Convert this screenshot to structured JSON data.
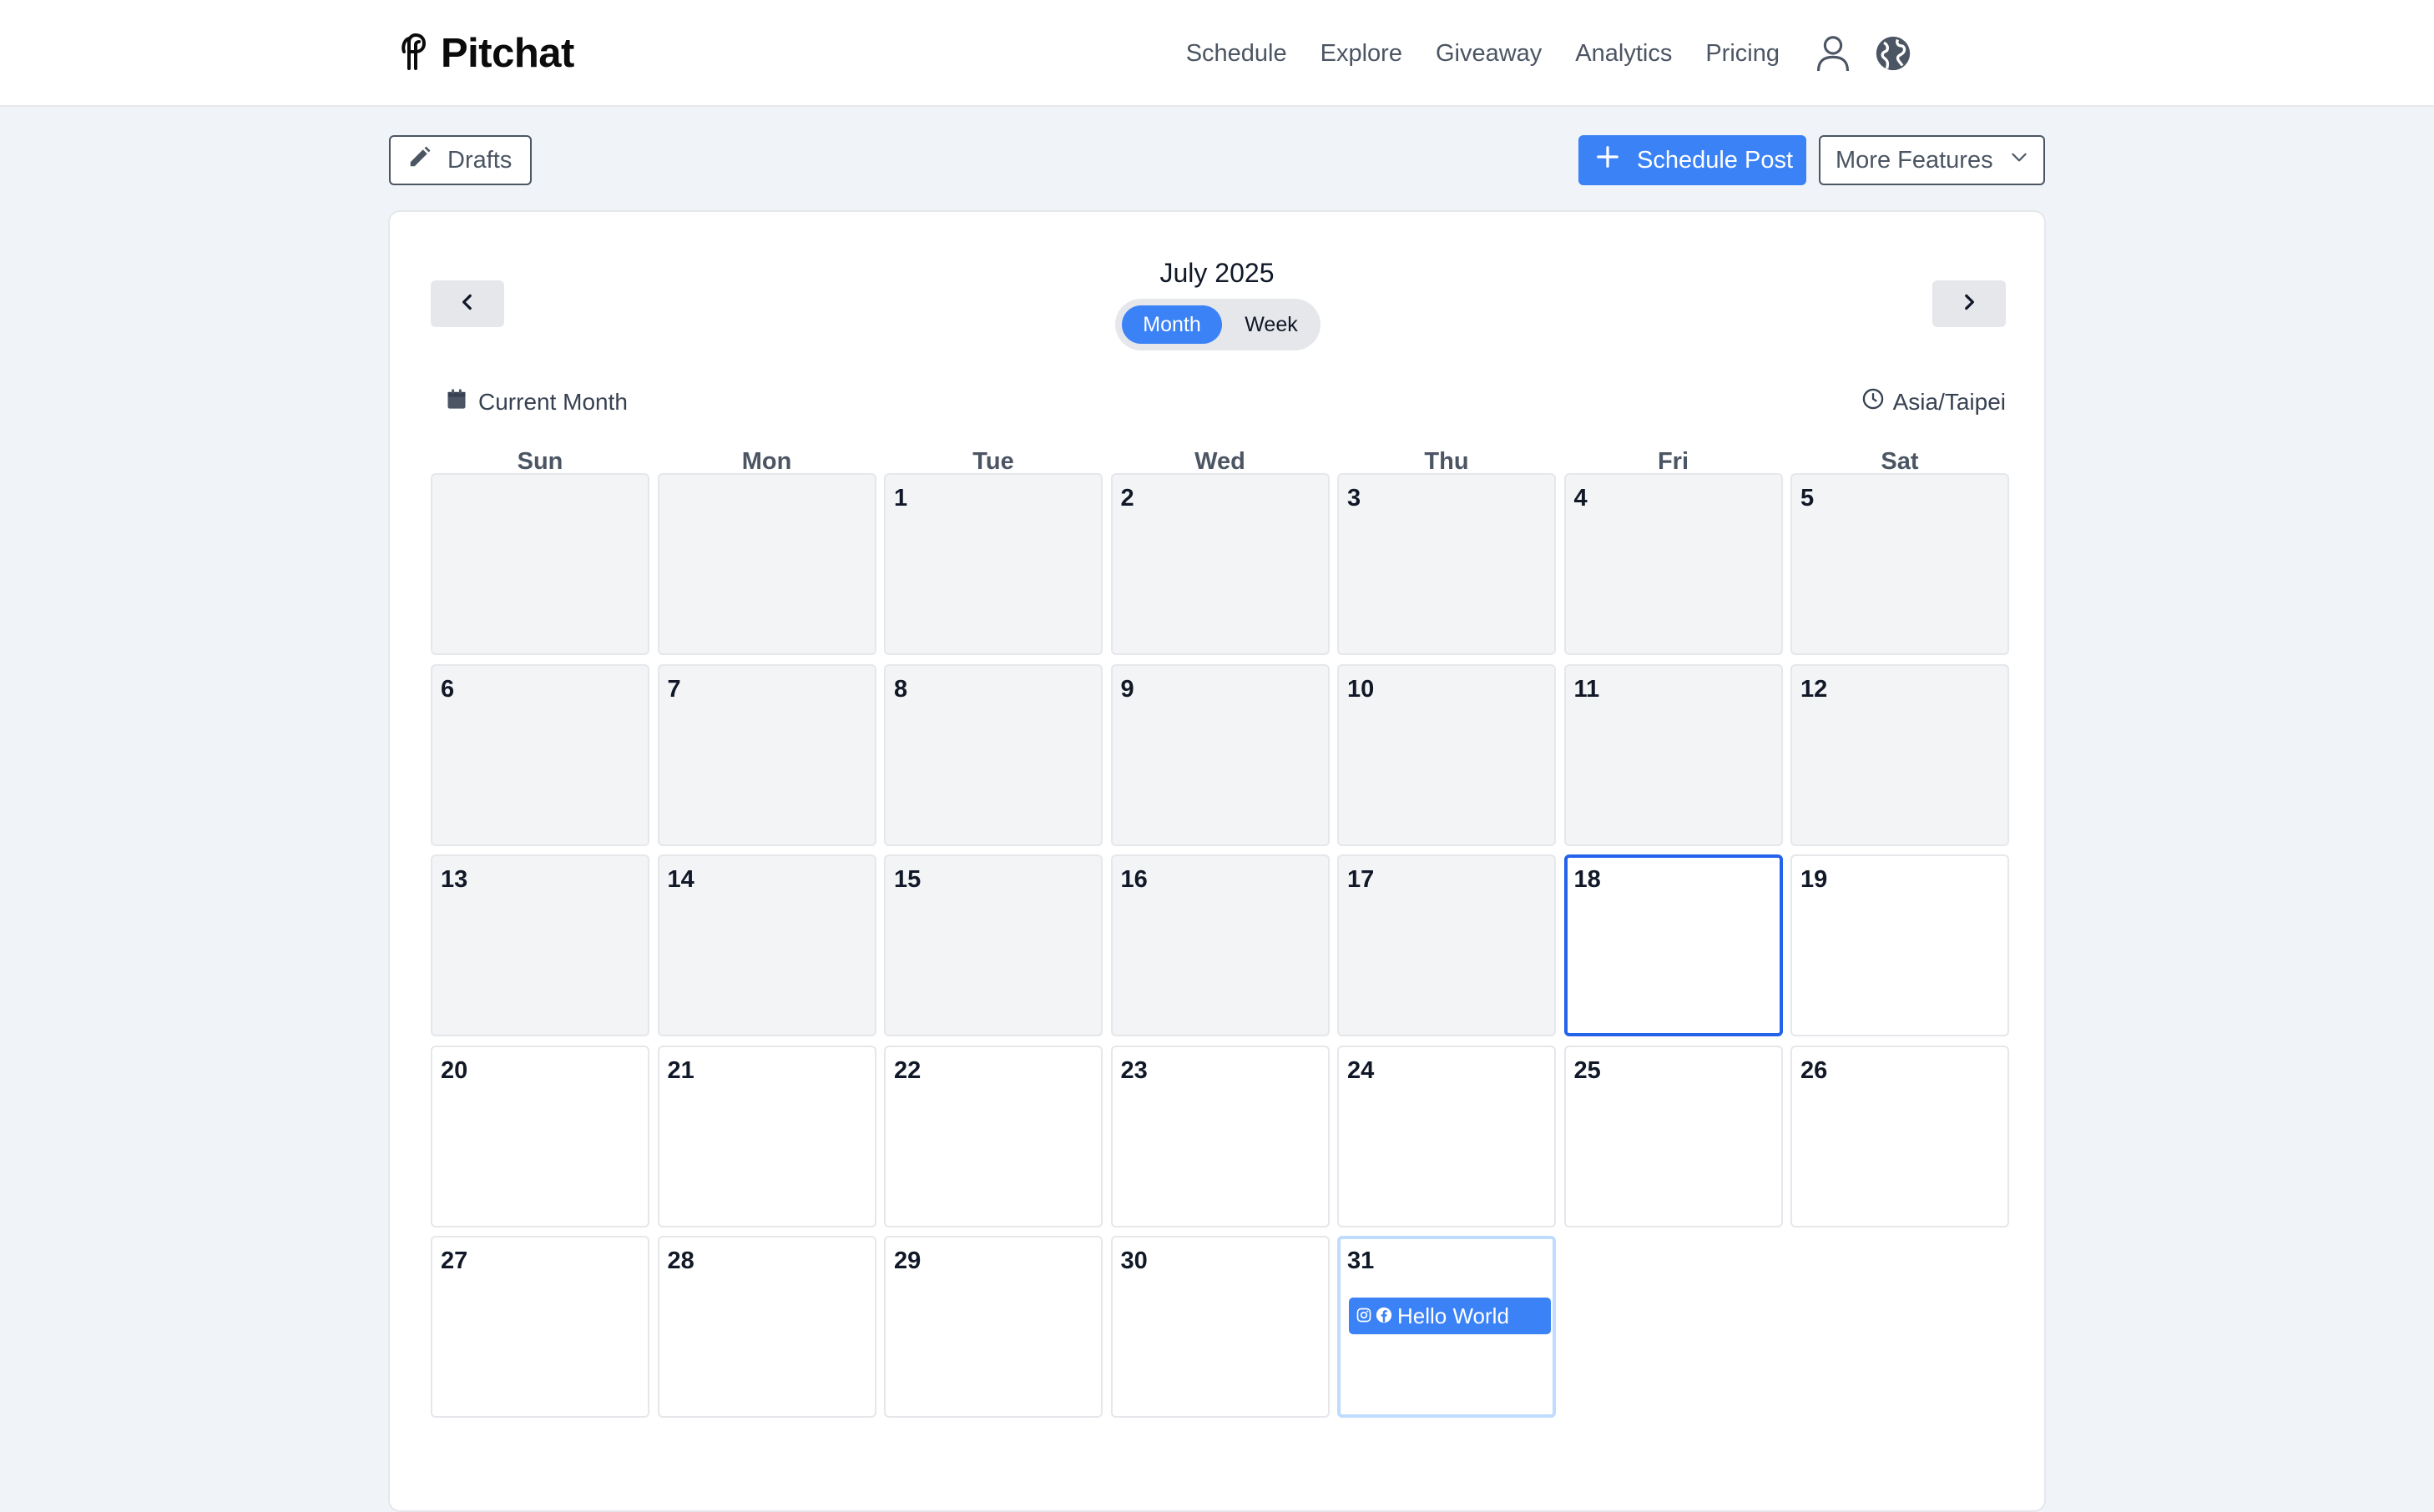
{
  "brand": {
    "name": "Pitchat"
  },
  "nav": {
    "items": [
      "Schedule",
      "Explore",
      "Giveaway",
      "Analytics",
      "Pricing"
    ]
  },
  "toolbar": {
    "drafts_label": "Drafts",
    "schedule_label": "Schedule Post",
    "more_label": "More Features"
  },
  "calendar": {
    "month_title": "July 2025",
    "view_options": [
      "Month",
      "Week"
    ],
    "selected_view": "Month",
    "current_month_label": "Current Month",
    "timezone": "Asia/Taipei",
    "weekdays": [
      "Sun",
      "Mon",
      "Tue",
      "Wed",
      "Thu",
      "Fri",
      "Sat"
    ],
    "first_weekday_index": 2,
    "days_in_month": 31,
    "today": 18,
    "events": [
      {
        "day": 31,
        "title": "Hello World",
        "platforms": [
          "instagram-icon",
          "facebook-icon"
        ]
      }
    ]
  },
  "colors": {
    "accent": "#3b82f6",
    "today_border": "#2563eb",
    "past_cell": "#f3f4f6",
    "page_bg": "#f0f3f8"
  }
}
